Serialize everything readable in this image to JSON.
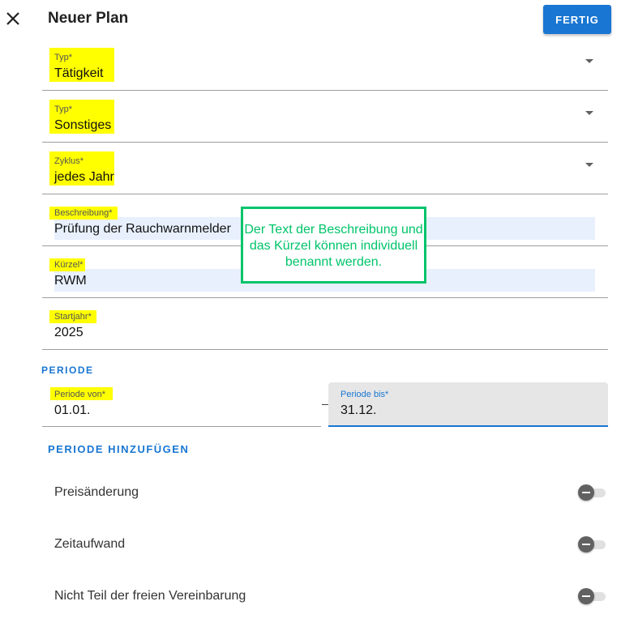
{
  "header": {
    "title": "Neuer Plan",
    "done_label": "FERTIG",
    "close_icon": "close-icon"
  },
  "fields": {
    "typ1": {
      "label": "Typ*",
      "value": "Tätigkeit"
    },
    "typ2": {
      "label": "Typ*",
      "value": "Sonstiges"
    },
    "zyklus": {
      "label": "Zyklus*",
      "value": "jedes Jahr"
    },
    "beschreibung": {
      "label": "Beschreibung*",
      "value": "Prüfung der Rauchwarnmelder"
    },
    "kuerzel": {
      "label": "Kürzel*",
      "value": "RWM"
    },
    "startjahr": {
      "label": "Startjahr*",
      "value": "2025"
    }
  },
  "periode": {
    "section_title": "PERIODE",
    "von": {
      "label": "Periode von*",
      "value": "01.01."
    },
    "separator": "–",
    "bis": {
      "label": "Periode bis*",
      "value": "31.12."
    },
    "add_label": "PERIODE HINZUFÜGEN"
  },
  "toggles": [
    {
      "label": "Preisänderung",
      "on": false
    },
    {
      "label": "Zeitaufwand",
      "on": false
    },
    {
      "label": "Nicht Teil der freien Vereinbarung",
      "on": false
    }
  ],
  "annotation": {
    "text": "Der Text der Beschreibung und das Kürzel können individuell benannt werden."
  },
  "colors": {
    "primary": "#1976d2",
    "highlight": "#ffff00",
    "annotation": "#00c46a",
    "autofill": "#e8f0fe"
  }
}
